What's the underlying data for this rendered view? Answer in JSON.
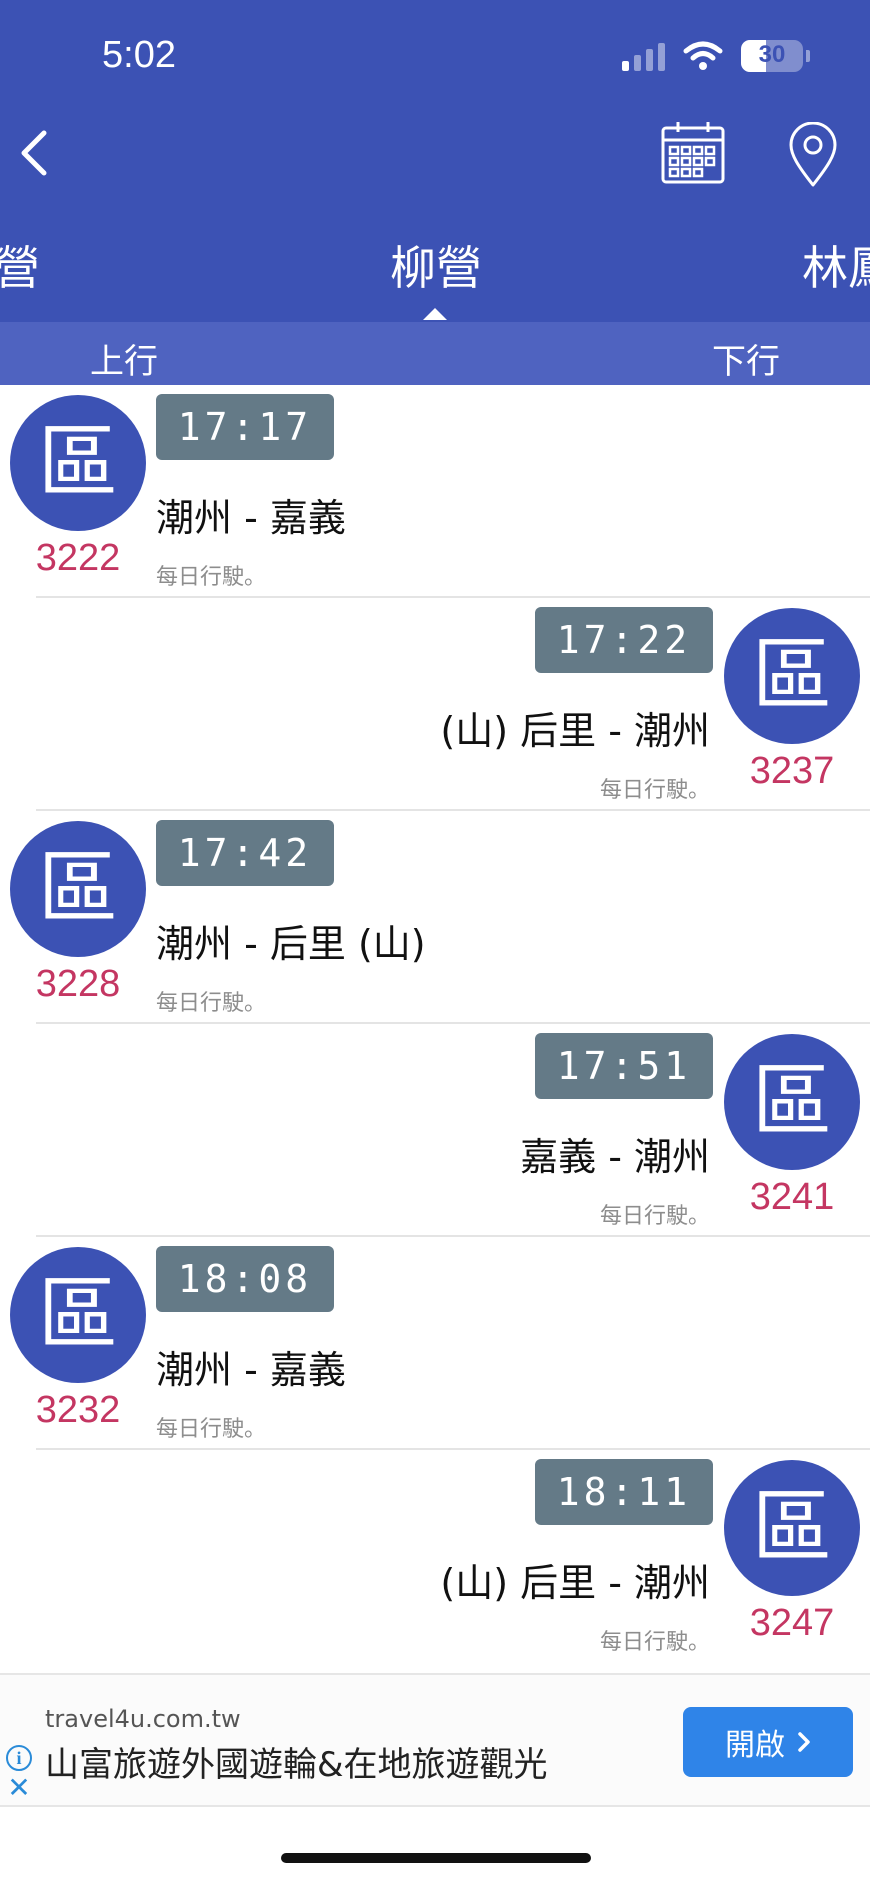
{
  "status_bar": {
    "time": "5:02",
    "battery": "30"
  },
  "header": {
    "stations": {
      "previous": "營",
      "current": "柳營",
      "next": "林鳳"
    },
    "directions": {
      "up": "上行",
      "down": "下行"
    }
  },
  "trains": [
    {
      "side": "left",
      "badge": "區",
      "time": "17:17",
      "route": "潮州 - 嘉義",
      "train_no": "3222",
      "note": "每日行駛。"
    },
    {
      "side": "right",
      "badge": "區",
      "time": "17:22",
      "route": "(山) 后里 - 潮州",
      "train_no": "3237",
      "note": "每日行駛。"
    },
    {
      "side": "left",
      "badge": "區",
      "time": "17:42",
      "route": "潮州 - 后里 (山)",
      "train_no": "3228",
      "note": "每日行駛。"
    },
    {
      "side": "right",
      "badge": "區",
      "time": "17:51",
      "route": "嘉義 - 潮州",
      "train_no": "3241",
      "note": "每日行駛。"
    },
    {
      "side": "left",
      "badge": "區",
      "time": "18:08",
      "route": "潮州 - 嘉義",
      "train_no": "3232",
      "note": "每日行駛。"
    },
    {
      "side": "right",
      "badge": "區",
      "time": "18:11",
      "route": "(山) 后里 - 潮州",
      "train_no": "3247",
      "note": "每日行駛。"
    }
  ],
  "ad": {
    "domain": "travel4u.com.tw",
    "title": "山富旅遊外國遊輪&在地旅遊觀光",
    "button": "開啟"
  },
  "colors": {
    "primary": "#3c52b4",
    "train_number": "#c43662",
    "time_box": "#647a87",
    "ad_button": "#2f84e8"
  }
}
